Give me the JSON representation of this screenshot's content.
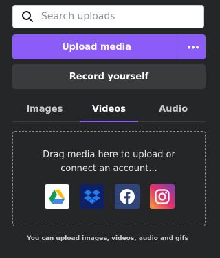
{
  "search": {
    "placeholder": "Search uploads"
  },
  "actions": {
    "upload_label": "Upload media",
    "more_label": "•••",
    "record_label": "Record yourself"
  },
  "tabs": [
    {
      "label": "Images",
      "active": false
    },
    {
      "label": "Videos",
      "active": true
    },
    {
      "label": "Audio",
      "active": false
    }
  ],
  "dropzone": {
    "line1": "Drag media here to upload or",
    "line2": "connect an account...",
    "sources": [
      {
        "name": "google-drive-icon",
        "bg": "#ffffff"
      },
      {
        "name": "dropbox-icon",
        "bg": "#0f2064"
      },
      {
        "name": "facebook-icon",
        "bg": "#2f4479"
      },
      {
        "name": "instagram-icon",
        "bg": "#c1359b"
      }
    ]
  },
  "footnote": "You can upload images, videos, audio and gifs",
  "colors": {
    "accent": "#8b5cf6",
    "background": "#252627",
    "secondary_button": "#3a3b3d"
  }
}
